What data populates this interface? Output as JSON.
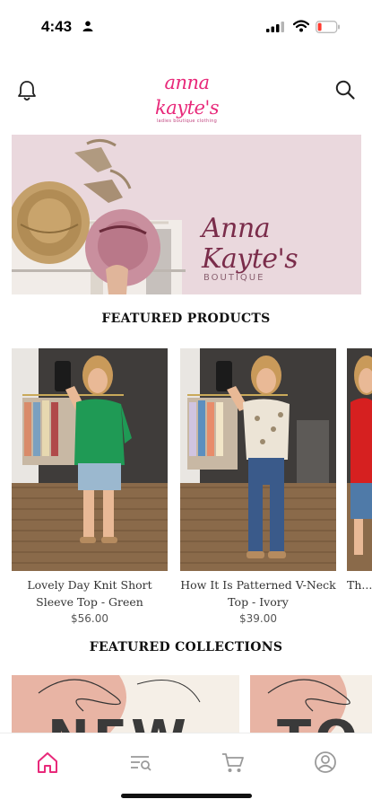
{
  "status_bar": {
    "time": "4:43"
  },
  "header": {
    "logo_text": "anna kayte's",
    "logo_tagline": "ladies boutique clothing"
  },
  "hero": {
    "title": "Anna Kayte's",
    "subtitle": "BOUTIQUE"
  },
  "featured_products": {
    "title": "FEATURED PRODUCTS",
    "items": [
      {
        "name": "Lovely Day Knit Short Sleeve Top - Green",
        "price": "$56.00"
      },
      {
        "name": "How It Is Patterned V-Neck Top - Ivory",
        "price": "$39.00"
      },
      {
        "name": "Th... Slee...",
        "price": ""
      }
    ]
  },
  "featured_collections": {
    "title": "FEATURED COLLECTIONS",
    "items": [
      {
        "label": "NEW"
      },
      {
        "label": "TO"
      }
    ]
  },
  "tab_bar": {
    "active_tab": "home",
    "tabs": [
      "home-icon",
      "search-list-icon",
      "cart-icon",
      "account-icon"
    ]
  },
  "colors": {
    "brand_pink": "#e8297a",
    "hero_bg": "#ead8dd",
    "hero_text": "#7a2c4a"
  }
}
